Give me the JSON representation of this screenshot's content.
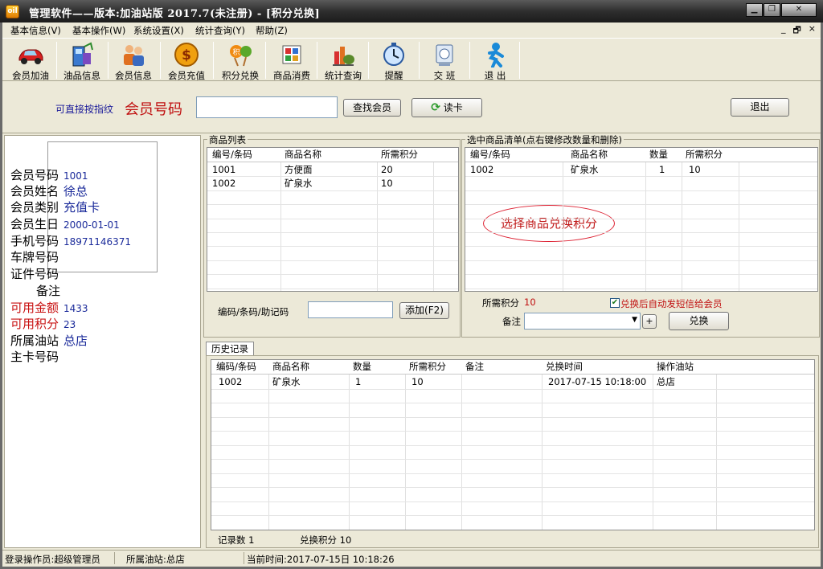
{
  "window": {
    "title": "管理软件——版本:加油站版 2017.7(未注册) - [积分兑换]",
    "app_icon": "oil",
    "controls": [
      "minimize-icon",
      "restore-icon",
      "close-icon"
    ]
  },
  "menu": {
    "items": [
      "基本信息(V)",
      "基本操作(W)",
      "系统设置(X)",
      "统计查询(Y)",
      "帮助(Z)"
    ],
    "mdi_controls": [
      "_",
      "🗗",
      "×"
    ]
  },
  "toolbar": {
    "buttons": [
      {
        "label": "会员加油",
        "icon": "car-icon"
      },
      {
        "label": "油品信息",
        "icon": "fuel-icon"
      },
      {
        "label": "会员信息",
        "icon": "people-icon"
      },
      {
        "label": "会员充值",
        "icon": "coin-icon"
      },
      {
        "label": "积分兑换",
        "icon": "gift-icon"
      },
      {
        "label": "商品消费",
        "icon": "goods-icon"
      },
      {
        "label": "统计查询",
        "icon": "stats-icon"
      },
      {
        "label": "提醒",
        "icon": "clock-icon"
      },
      {
        "label": "交 班",
        "icon": "handover-icon"
      },
      {
        "label": "退 出",
        "icon": "exit-icon"
      }
    ]
  },
  "search": {
    "hint": "可直接按指纹",
    "member_no_label": "会员号码",
    "member_no_value": "",
    "find_button": "查找会员",
    "read_card_button": "读卡",
    "exit_button": "退出"
  },
  "member": {
    "fields": [
      {
        "label": "会员号码",
        "value": "1001",
        "small": true,
        "red": false
      },
      {
        "label": "会员姓名",
        "value": "徐总",
        "small": false,
        "red": false
      },
      {
        "label": "会员类别",
        "value": "充值卡",
        "small": false,
        "red": false
      },
      {
        "label": "会员生日",
        "value": "2000-01-01",
        "small": true,
        "red": false
      },
      {
        "label": "手机号码",
        "value": "18971146371",
        "small": true,
        "red": false
      },
      {
        "label": "车牌号码",
        "value": "",
        "small": true,
        "red": false
      },
      {
        "label": "证件号码",
        "value": "",
        "small": true,
        "red": false
      },
      {
        "label": "备注",
        "value": "",
        "small": true,
        "red": false
      },
      {
        "label": "可用金额",
        "value": "1433",
        "small": true,
        "red": true
      },
      {
        "label": "可用积分",
        "value": "23",
        "small": true,
        "red": true
      },
      {
        "label": "所属油站",
        "value": "总店",
        "small": false,
        "red": false
      },
      {
        "label": "主卡号码",
        "value": "",
        "small": true,
        "red": false
      }
    ]
  },
  "product_list": {
    "title": "商品列表",
    "columns": [
      "编号/条码",
      "商品名称",
      "所需积分"
    ],
    "rows": [
      [
        "1001",
        "方便面",
        "20"
      ],
      [
        "1002",
        "矿泉水",
        "10"
      ]
    ],
    "code_label": "编码/条码/助记码",
    "code_value": "",
    "add_button": "添加(F2)"
  },
  "selected_list": {
    "title": "选中商品清单(点右键修改数量和删除)",
    "columns": [
      "编号/条码",
      "商品名称",
      "数量",
      "所需积分"
    ],
    "rows": [
      [
        "1002",
        "矿泉水",
        "1",
        "10"
      ]
    ],
    "annotation": "选择商品兑换积分",
    "points_label": "所需积分",
    "points_value": "10",
    "sms_checkbox_label": "兑换后自动发短信给会员",
    "sms_checked": true,
    "remark_label": "备注",
    "remark_value": "",
    "plus_button": "+",
    "redeem_button": "兑换"
  },
  "history": {
    "tab": "历史记录",
    "columns": [
      "编码/条码",
      "商品名称",
      "数量",
      "所需积分",
      "备注",
      "兑换时间",
      "操作油站"
    ],
    "rows": [
      [
        "1002",
        "矿泉水",
        "1",
        "10",
        "",
        "2017-07-15 10:18:00",
        "总店"
      ]
    ],
    "record_count": "记录数 1",
    "redeem_points": "兑换积分 10"
  },
  "status": {
    "operator": "登录操作员:超级管理员",
    "station": "所属油站:总店",
    "time": "当前时间:2017-07-15日 10:18:26"
  }
}
